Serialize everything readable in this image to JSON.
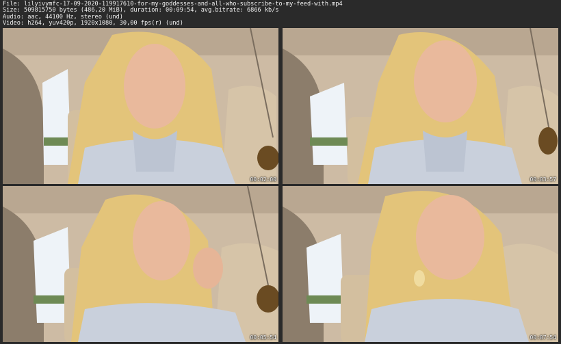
{
  "header": {
    "line1": "File: lilyivymfc-17-09-2020-119917610-for-my-goddesses-and-all-who-subscribe-to-my-feed-with.mp4",
    "line2": "Size: 509815750 bytes (486,20 MiB), duration: 00:09:54, avg.bitrate: 6866 kb/s",
    "line3": "Audio: aac, 44100 Hz, stereo (und)",
    "line4": "Video: h264, yuv420p, 1920x1080, 30,00 fps(r) (und)"
  },
  "thumbnails": [
    {
      "timestamp": "00:02:00"
    },
    {
      "timestamp": "00:03:57"
    },
    {
      "timestamp": "00:05:54"
    },
    {
      "timestamp": "00:07:54"
    }
  ],
  "colors": {
    "background": "#2a2a2a",
    "text": "#f2f2f2",
    "car_interior": "#c9b7a0",
    "hair": "#e3c47a",
    "sweater": "#c9d0dc"
  }
}
